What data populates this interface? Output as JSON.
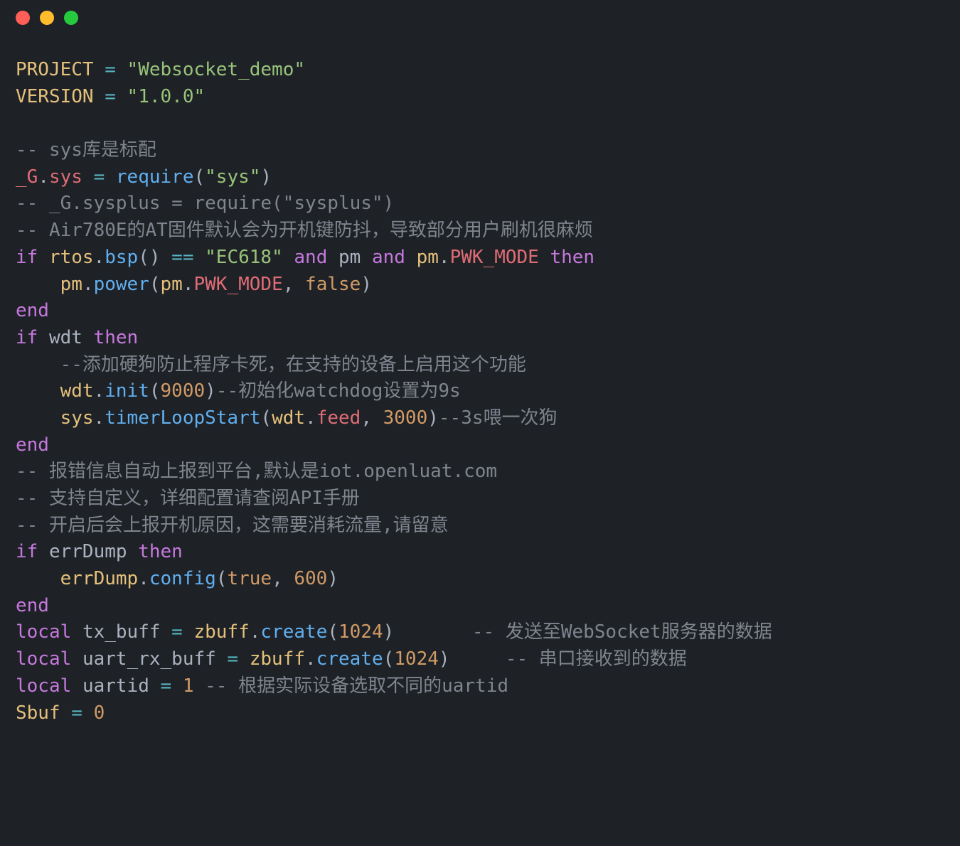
{
  "window": {
    "buttons": [
      "close",
      "minimize",
      "zoom"
    ]
  },
  "code": {
    "PROJECT": "PROJECT",
    "eq": " = ",
    "str_ws": "\"Websocket_demo\"",
    "VERSION": "VERSION",
    "str_ver": "\"1.0.0\"",
    "cmt_sys": "-- sys库是标配",
    "G": "_G",
    "dot": ".",
    "sys": "sys",
    "require": "require",
    "lp": "(",
    "rp": ")",
    "str_sys": "\"sys\"",
    "cmt_sysplus": "-- _G.sysplus = require(\"sysplus\")",
    "cmt_air": "-- Air780E的AT固件默认会为开机键防抖，导致部分用户刷机很麻烦",
    "if": "if",
    "rtos": "rtos",
    "bsp": "bsp",
    "eqeq": " == ",
    "str_ec": "\"EC618\"",
    "and": " and ",
    "pm": "pm",
    "PWK_MODE": "PWK_MODE",
    "then": " then",
    "indent": "    ",
    "power": "power",
    "comma": ", ",
    "false": "false",
    "end": "end",
    "wdt": "wdt",
    "cmt_wdtadd": "--添加硬狗防止程序卡死，在支持的设备上启用这个功能",
    "init": "init",
    "n9000": "9000",
    "cmt_wdt9s": "--初始化watchdog设置为9s",
    "timerLoopStart": "timerLoopStart",
    "feed": "feed",
    "n3000": "3000",
    "cmt_3s": "--3s喂一次狗",
    "cmt_err1": "-- 报错信息自动上报到平台,默认是iot.openluat.com",
    "cmt_err2": "-- 支持自定义，详细配置请查阅API手册",
    "cmt_err3": "-- 开启后会上报开机原因，这需要消耗流量,请留意",
    "errDump": "errDump",
    "config": "config",
    "true": "true",
    "n600": "600",
    "local": "local",
    "tx_buff": "tx_buff",
    "zbuff": "zbuff",
    "create": "create",
    "n1024": "1024",
    "pad_tx": "       ",
    "cmt_tx": "-- 发送至WebSocket服务器的数据",
    "uart_rx_buff": "uart_rx_buff",
    "pad_rx": "     ",
    "cmt_rx": "-- 串口接收到的数据",
    "uartid": "uartid",
    "n1": "1",
    "cmt_uartid": " -- 根据实际设备选取不同的uartid",
    "Sbuf": "Sbuf",
    "n0": "0"
  }
}
